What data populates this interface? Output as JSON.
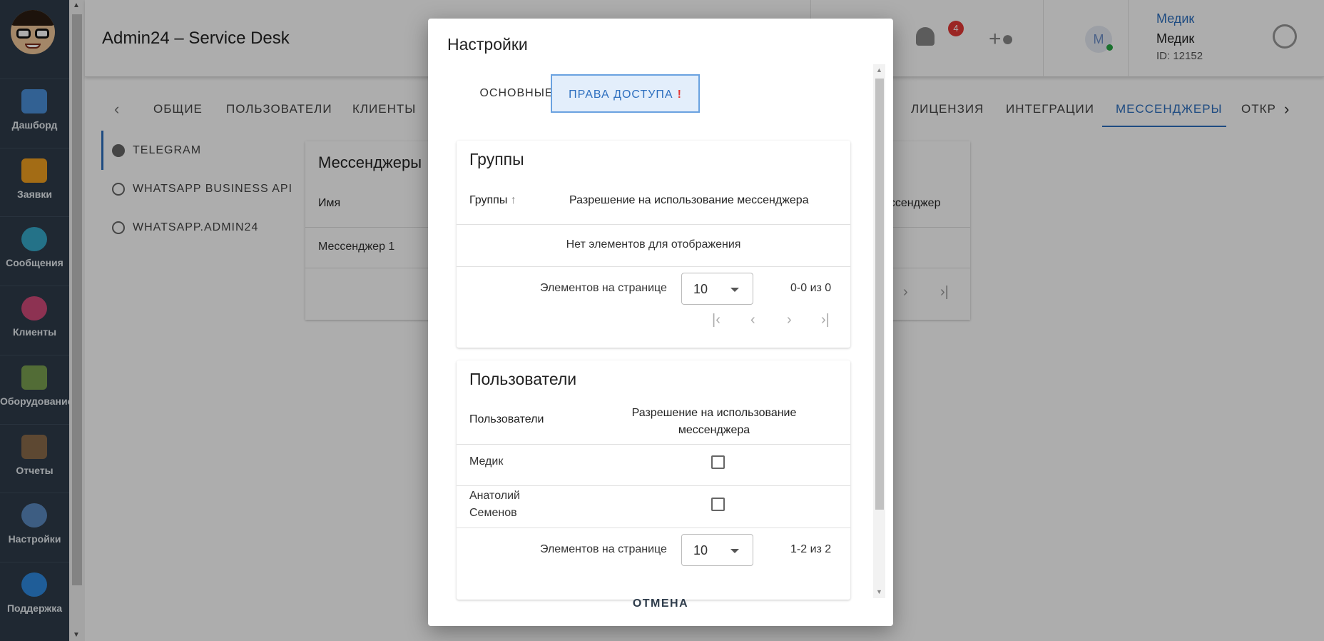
{
  "header": {
    "app_title": "Admin24 – Service Desk",
    "notifications_count": "4",
    "user_avatar_letter": "М",
    "user_link": "Медик",
    "user_name": "Медик",
    "user_id": "ID: 12152"
  },
  "leftnav": {
    "items": [
      {
        "label": "Дашборд",
        "icon": "dashboard-icon",
        "color": "#4a90d9"
      },
      {
        "label": "Заявки",
        "icon": "megaphone-icon",
        "color": "#f0a020"
      },
      {
        "label": "Сообщения",
        "icon": "chat-icon",
        "color": "#35a8c9"
      },
      {
        "label": "Клиенты",
        "icon": "clients-icon",
        "color": "#d04a7a"
      },
      {
        "label": "Оборудование",
        "icon": "equipment-icon",
        "color": "#7aa050"
      },
      {
        "label": "Отчеты",
        "icon": "reports-icon",
        "color": "#8a6a4a"
      },
      {
        "label": "Настройки",
        "icon": "gear-icon",
        "color": "#5a8ac0"
      },
      {
        "label": "Поддержка",
        "icon": "help-icon",
        "color": "#2e8ae0"
      }
    ]
  },
  "settings_tabs": {
    "items": [
      "ОБЩИЕ",
      "ПОЛЬЗОВАТЕЛИ",
      "КЛИЕНТЫ",
      "ЛИЦЕНЗИЯ",
      "ИНТЕГРАЦИИ",
      "МЕССЕНДЖЕРЫ",
      "ОТКР"
    ],
    "active": "МЕССЕНДЖЕРЫ"
  },
  "subnav": {
    "items": [
      "TELEGRAM",
      "WHATSAPP BUSINESS API",
      "WHATSAPP.ADMIN24"
    ]
  },
  "bg_card": {
    "title": "Мессенджеры",
    "col_name": "Имя",
    "col_messenger": "ессенджер",
    "row1_name": "Мессенджер 1"
  },
  "modal": {
    "title": "Настройки",
    "tabs": {
      "basic": "ОСНОВНЫЕ",
      "access": "ПРАВА ДОСТУПА",
      "access_alert": "!"
    },
    "groups_panel": {
      "title": "Группы",
      "col_groups": "Группы",
      "col_permission": "Разрешение на использование мессенджера",
      "empty_text": "Нет элементов для отображения",
      "per_page_label": "Элементов на странице",
      "per_page_value": "10",
      "range": "0-0 из 0"
    },
    "users_panel": {
      "title": "Пользователи",
      "col_users": "Пользователи",
      "col_permission_line1": "Разрешение на использование",
      "col_permission_line2": "мессенджера",
      "rows": [
        {
          "name_line1": "Медик",
          "name_line2": "",
          "checked": false
        },
        {
          "name_line1": "Анатолий",
          "name_line2": "Семенов",
          "checked": false
        }
      ],
      "per_page_label": "Элементов на странице",
      "per_page_value": "10",
      "range": "1-2 из 2"
    },
    "cancel_label": "ОТМЕНА"
  },
  "colors": {
    "nav_bg": "#2e3c4b",
    "accent": "#2d6fbf",
    "alert": "#e53935"
  }
}
